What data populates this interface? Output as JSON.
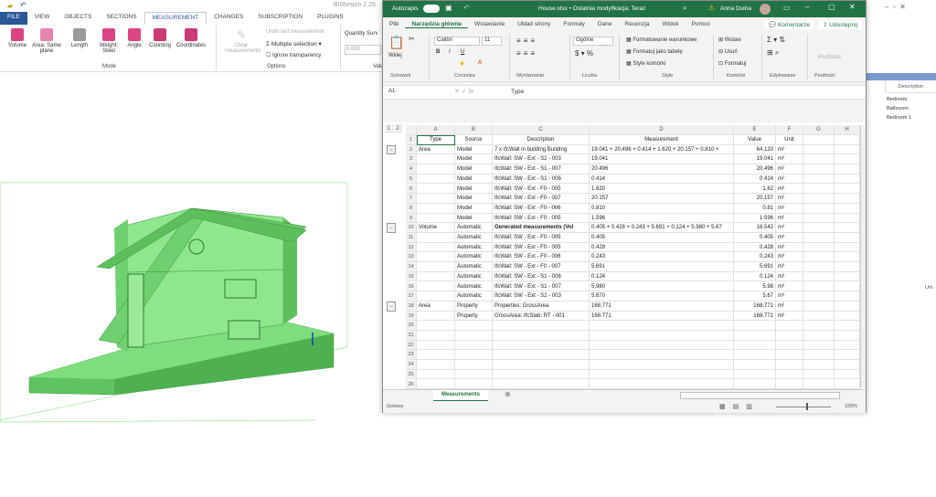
{
  "bim": {
    "title": "BIMvision 2.26.",
    "tabs": [
      "FILE",
      "VIEW",
      "OBJECTS",
      "SECTIONS",
      "MEASUREMENT",
      "CHANGES",
      "SUBSCRIPTION",
      "PLUGINS"
    ],
    "mode_buttons": [
      "Volume",
      "Area: Same plane",
      "Length",
      "Weight: Steel",
      "Angle",
      "Counting",
      "Coordinates"
    ],
    "mode_group": "Mode",
    "clear": "Clear measurements",
    "undo": "Undo last measurement",
    "multi": "Multiple selection",
    "ignore": "Ignore transparency",
    "options_group": "Options",
    "qs_label": "Quantity Surv",
    "qs_value": "0.000",
    "value_group": "Valu",
    "panel_header": "Description",
    "panel_rows": [
      "Bedroom",
      "Bathroom",
      "Bedroom 1"
    ],
    "panel_unit": "Uni"
  },
  "excel": {
    "autosave": "Autozapis",
    "title": "House.xlsx • Ostatnia modyfikacja: Teraz",
    "user": "Anna Dulna",
    "tabs": [
      "Plik",
      "Narzędzia główne",
      "Wstawianie",
      "Układ strony",
      "Formuły",
      "Dane",
      "Recenzja",
      "Widok",
      "Pomoc"
    ],
    "comments": "Komentarze",
    "share": "Udostępnij",
    "ribbon": {
      "paste": "Wklej",
      "font": "Calibri",
      "size": "11",
      "number_format": "Ogólne",
      "cond": "Formatowanie warunkowe",
      "table": "Formatuj jako tabelę",
      "styles": "Style komórki",
      "insert": "Wstaw",
      "delete": "Usuń",
      "format": "Formatuj",
      "sens": "Poufność",
      "groups": [
        "Schowek",
        "Czcionka",
        "Wyrównanie",
        "Liczba",
        "Style",
        "Komórki",
        "Edytowanie",
        "Poufność"
      ]
    },
    "namebox": "A1",
    "formula": "Type",
    "columns": [
      "A",
      "B",
      "C",
      "D",
      "E",
      "F",
      "G",
      "H"
    ],
    "header": [
      "Type",
      "Source",
      "Description",
      "Measurement",
      "Value",
      "Unit"
    ],
    "rows": [
      [
        "Area",
        "Model",
        "7 x IfcWall in building Building",
        "19.041 + 20.496 + 0.414 + 1.620 + 20.157 + 0.810 +",
        "64.133",
        "m²"
      ],
      [
        "",
        "Model",
        "IfcWall: SW - Ext - S2 - 003",
        "19.041",
        "19.041",
        "m²"
      ],
      [
        "",
        "Model",
        "IfcWall: SW - Ext - S1 - 007",
        "20.496",
        "20.496",
        "m²"
      ],
      [
        "",
        "Model",
        "IfcWall: SW - Ext - S1 - 006",
        "0.414",
        "0.414",
        "m²"
      ],
      [
        "",
        "Model",
        "IfcWall: SW - Ext - F0 - 005",
        "1.620",
        "1.62",
        "m²"
      ],
      [
        "",
        "Model",
        "IfcWall: SW - Ext - F0 - 007",
        "20.157",
        "20.157",
        "m²"
      ],
      [
        "",
        "Model",
        "IfcWall: SW - Ext - F0 - 006",
        "0.810",
        "0.81",
        "m²"
      ],
      [
        "",
        "Model",
        "IfcWall: SW - Ext - F0 - 005",
        "1.596",
        "1.596",
        "m²"
      ],
      [
        "Volume",
        "Automatic",
        "Generated measurements (Vol",
        "0.405 + 0.428 + 0.243 + 5.691 + 0.124 + 5.980 + 5.67",
        "18.542",
        "m³"
      ],
      [
        "",
        "Automatic",
        "IfcWall: SW - Ext - F0 - 005",
        "0.405",
        "0.405",
        "m³"
      ],
      [
        "",
        "Automatic",
        "IfcWall: SW - Ext - F0 - 005",
        "0.428",
        "0.428",
        "m³"
      ],
      [
        "",
        "Automatic",
        "IfcWall: SW - Ext - F0 - 006",
        "0.243",
        "0.243",
        "m³"
      ],
      [
        "",
        "Automatic",
        "IfcWall: SW - Ext - F0 - 007",
        "5.691",
        "5.691",
        "m³"
      ],
      [
        "",
        "Automatic",
        "IfcWall: SW - Ext - S1 - 006",
        "0.124",
        "0.124",
        "m³"
      ],
      [
        "",
        "Automatic",
        "IfcWall: SW - Ext - S1 - 007",
        "5.980",
        "5.98",
        "m³"
      ],
      [
        "",
        "Automatic",
        "IfcWall: SW - Ext - S2 - 003",
        "5.670",
        "5.67",
        "m³"
      ],
      [
        "Area",
        "Property",
        "Properties: GrossArea",
        "168.771",
        "168.771",
        "m²"
      ],
      [
        "",
        "Property",
        "GrossArea: IfcSlab: RT - 001",
        "168.771",
        "168.771",
        "m²"
      ]
    ],
    "total_rows": 26,
    "sheet": "Measurements",
    "status": "Gotowy",
    "zoom": "100%"
  },
  "colors": {
    "excel_green": "#217346",
    "model_green": "#7fdc7f"
  }
}
